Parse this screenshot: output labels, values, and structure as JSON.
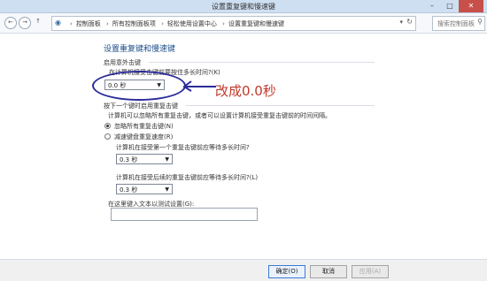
{
  "window": {
    "title": "设置重复键和慢速键",
    "minimize_icon": "minimize-icon",
    "maximize_icon": "maximize-icon",
    "close_icon": "close-icon"
  },
  "toolbar": {
    "breadcrumbs": [
      "控制面板",
      "所有控制面板项",
      "轻松使用设置中心",
      "设置重复键和慢速键"
    ],
    "search_placeholder": "搜索控制面板"
  },
  "main": {
    "title": "设置重复键和慢速键",
    "section1": {
      "heading": "启用意外击键",
      "question": "在计算机接受击键前要按住多长时间?(K)",
      "selected": "0.0 秒"
    },
    "section2": {
      "heading": "按下一个键时启用重复击键",
      "description": "计算机可以忽略所有重复击键，或者可以设置计算机接受重复击键前的时间间隔。",
      "options": [
        "忽略所有重复击键(N)",
        "减速键盘重复速度(R)"
      ],
      "first_delay_question": "计算机在接受第一个重复击键前应等待多长时间?",
      "first_delay_value": "0.3 秒",
      "subsequent_delay_question": "计算机在接受后续的重复击键前应等待多长时间?(L)",
      "subsequent_delay_value": "0.3 秒",
      "test_label": "在这里键入文本以测试设置(G):",
      "test_value": ""
    },
    "annotation": "改成0.0秒"
  },
  "footer": {
    "ok": "确定(O)",
    "cancel": "取消",
    "apply": "应用(A)"
  },
  "colors": {
    "titlebar": "#cfdff2",
    "heading": "#1d4e8a",
    "annotation": "#c0392b",
    "ellipse": "#2b2c9a"
  }
}
